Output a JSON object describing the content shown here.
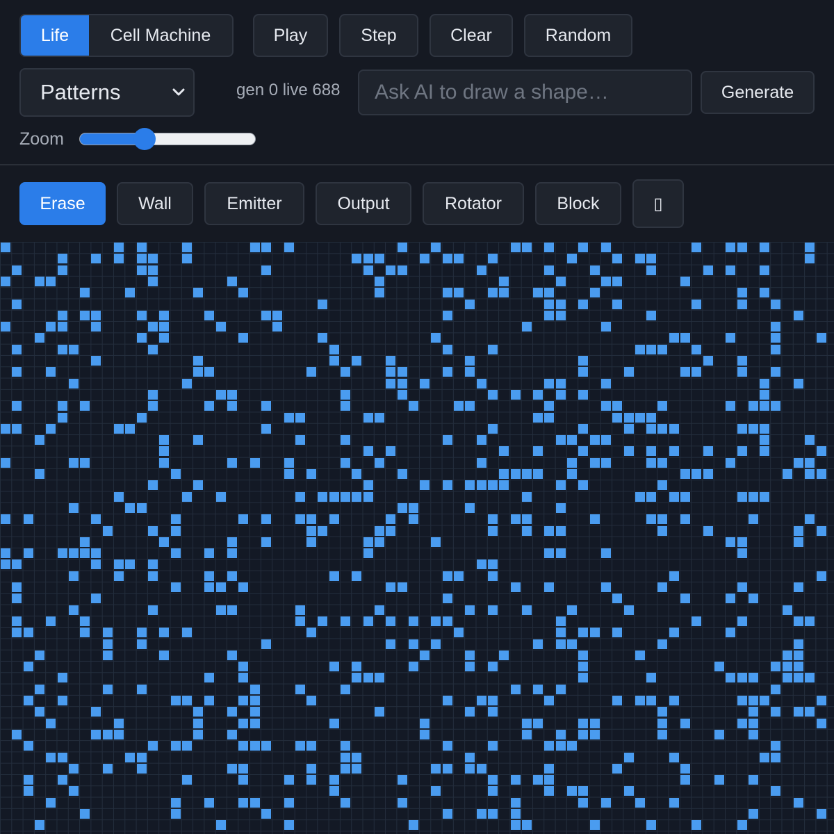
{
  "modes": [
    {
      "label": "Life",
      "active": true
    },
    {
      "label": "Cell Machine",
      "active": false
    }
  ],
  "controls": {
    "play_label": "Play",
    "step_label": "Step",
    "clear_label": "Clear",
    "random_label": "Random",
    "generate_label": "Generate"
  },
  "patterns": {
    "selected": "Patterns"
  },
  "status": {
    "text": "gen 0 live 688"
  },
  "ai": {
    "placeholder": "Ask AI to draw a shape…",
    "value": ""
  },
  "zoom": {
    "label": "Zoom",
    "level": 0.35
  },
  "tools": [
    {
      "label": "Erase",
      "active": true
    },
    {
      "label": "Wall",
      "active": false
    },
    {
      "label": "Emitter",
      "active": false
    },
    {
      "label": "Output",
      "active": false
    },
    {
      "label": "Rotator",
      "active": false
    },
    {
      "label": "Block",
      "active": false
    }
  ],
  "tools_extra": {
    "icon": "missing-glyph-icon",
    "glyph": "▯"
  },
  "colors": {
    "accent": "#2b7de9",
    "cell": "#4a9cf0",
    "background": "#151922",
    "grid_line": "#232d3c"
  }
}
